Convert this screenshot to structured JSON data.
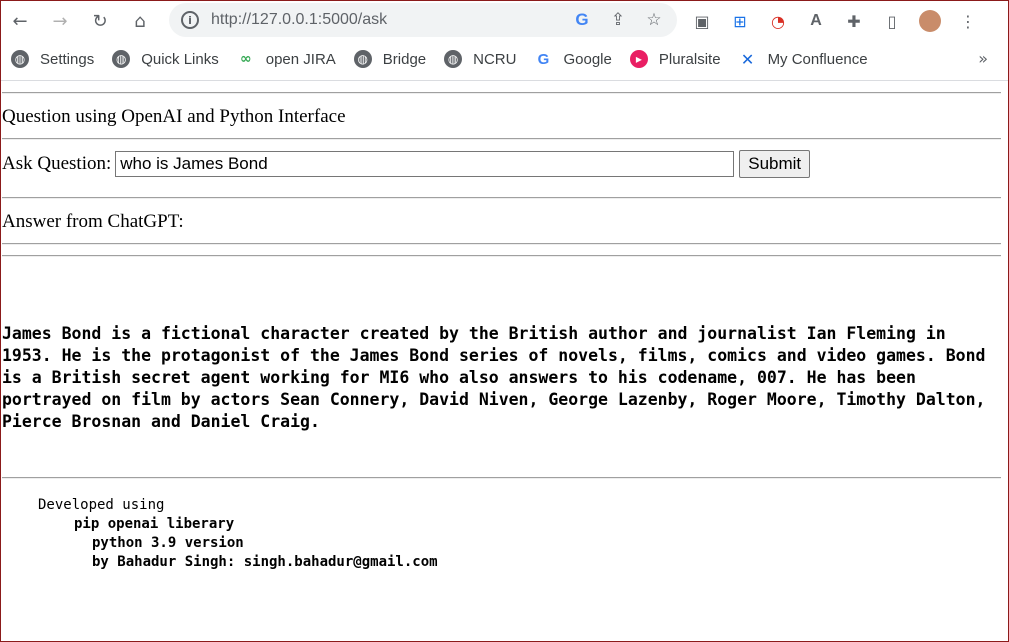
{
  "browser": {
    "url": "http://127.0.0.1:5000/ask",
    "bookmarks": [
      {
        "label": "Settings",
        "icon": "globe-icon"
      },
      {
        "label": "Quick Links",
        "icon": "globe-icon"
      },
      {
        "label": "open JIRA",
        "icon": "jira-icon"
      },
      {
        "label": "Bridge",
        "icon": "globe-icon"
      },
      {
        "label": "NCRU",
        "icon": "globe-icon"
      },
      {
        "label": "Google",
        "icon": "google-icon"
      },
      {
        "label": "Pluralsite",
        "icon": "pluralsight-icon"
      },
      {
        "label": "My Confluence",
        "icon": "confluence-icon"
      }
    ],
    "more_bookmarks": "»"
  },
  "page": {
    "title": "Question using OpenAI and Python Interface",
    "ask_label": "Ask Question:",
    "question_value": "who is James Bond",
    "submit_label": "Submit",
    "answer_label": "Answer from ChatGPT:",
    "answer_text": "James Bond is a fictional character created by the British author and journalist Ian Fleming in 1953. He is the protagonist of the James Bond series of novels, films, comics and video games. Bond is a British secret agent working for MI6 who also answers to his codename, 007. He has been portrayed on film by actors Sean Connery, David Niven, George Lazenby, Roger Moore, Timothy Dalton, Pierce Brosnan and Daniel Craig.",
    "footer": {
      "line1": "Developed using",
      "line2": "pip openai liberary",
      "line3": "python 3.9 version",
      "line4": "by Bahadur Singh: singh.bahadur@gmail.com"
    }
  },
  "colors": {
    "frame_border": "#8b1a1a",
    "omnibox_bg": "#f1f3f4",
    "icon_gray": "#5f6368"
  }
}
